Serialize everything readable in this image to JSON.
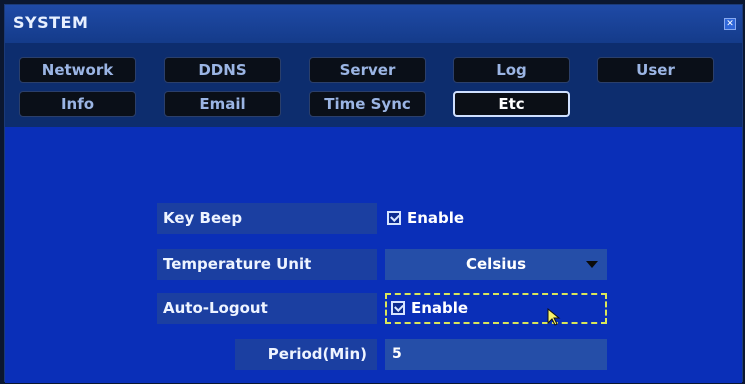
{
  "window": {
    "title": "SYSTEM",
    "close_icon": "close-icon"
  },
  "tabs": {
    "row1": [
      {
        "label": "Network"
      },
      {
        "label": "DDNS"
      },
      {
        "label": "Server"
      },
      {
        "label": "Log"
      },
      {
        "label": "User"
      }
    ],
    "row2": [
      {
        "label": "Info"
      },
      {
        "label": "Email"
      },
      {
        "label": "Time Sync"
      },
      {
        "label": "Etc"
      }
    ],
    "active": "Etc"
  },
  "settings": {
    "key_beep": {
      "label": "Key Beep",
      "checkbox_label": "Enable",
      "checked": true
    },
    "temperature_unit": {
      "label": "Temperature Unit",
      "value": "Celsius"
    },
    "auto_logout": {
      "label": "Auto-Logout",
      "checkbox_label": "Enable",
      "checked": true
    },
    "period": {
      "label": "Period(Min)",
      "value": "5"
    }
  },
  "colors": {
    "window_bg": "#0d2a63",
    "content_bg": "#0a2fb8",
    "label_bg": "#1b3fa1",
    "control_bg": "#254ea8",
    "focus_border": "#d9e65a"
  }
}
